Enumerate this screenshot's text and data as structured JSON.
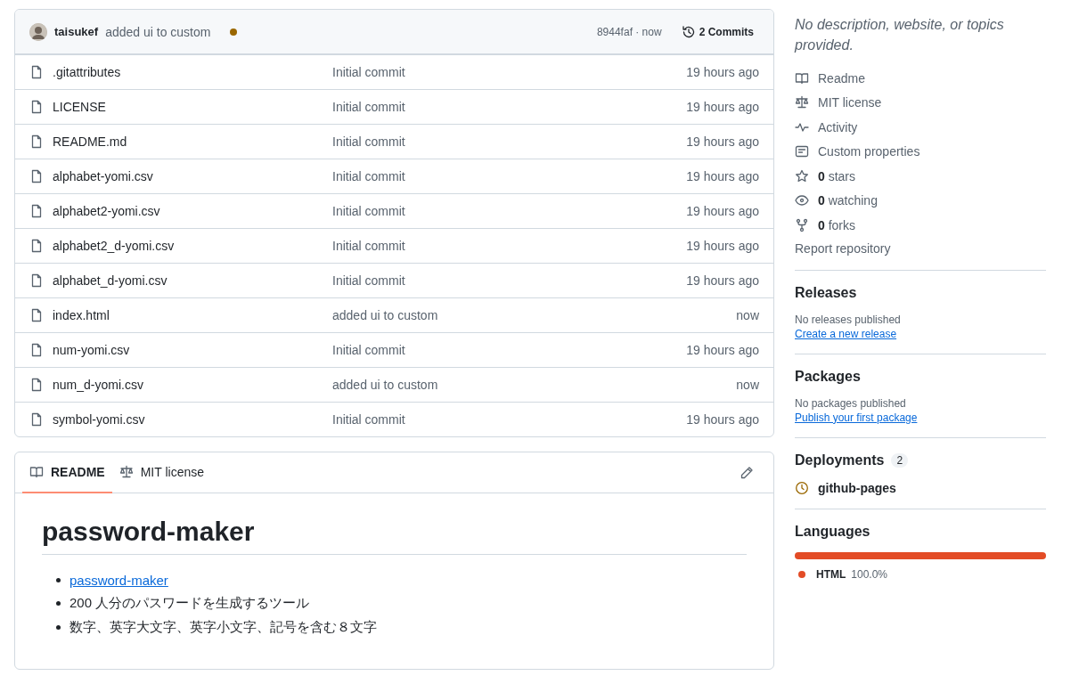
{
  "commit_bar": {
    "author": "taisukef",
    "message": "added ui to custom",
    "checks_pending": true,
    "hash": "8944faf · now",
    "commits": "2 Commits"
  },
  "files": [
    {
      "name": ".gitattributes",
      "message": "Initial commit",
      "time": "19 hours ago"
    },
    {
      "name": "LICENSE",
      "message": "Initial commit",
      "time": "19 hours ago"
    },
    {
      "name": "README.md",
      "message": "Initial commit",
      "time": "19 hours ago"
    },
    {
      "name": "alphabet-yomi.csv",
      "message": "Initial commit",
      "time": "19 hours ago"
    },
    {
      "name": "alphabet2-yomi.csv",
      "message": "Initial commit",
      "time": "19 hours ago"
    },
    {
      "name": "alphabet2_d-yomi.csv",
      "message": "Initial commit",
      "time": "19 hours ago"
    },
    {
      "name": "alphabet_d-yomi.csv",
      "message": "Initial commit",
      "time": "19 hours ago"
    },
    {
      "name": "index.html",
      "message": "added ui to custom",
      "time": "now"
    },
    {
      "name": "num-yomi.csv",
      "message": "Initial commit",
      "time": "19 hours ago"
    },
    {
      "name": "num_d-yomi.csv",
      "message": "added ui to custom",
      "time": "now"
    },
    {
      "name": "symbol-yomi.csv",
      "message": "Initial commit",
      "time": "19 hours ago"
    }
  ],
  "readme": {
    "tabs": [
      {
        "label": "README",
        "kind": "book",
        "selected": true
      },
      {
        "label": "MIT license",
        "kind": "scale",
        "selected": false
      }
    ],
    "title": "password-maker",
    "items": [
      {
        "kind": "link",
        "text": "password-maker"
      },
      {
        "kind": "text",
        "text": "200 人分のパスワードを生成するツール"
      },
      {
        "kind": "text",
        "text": "数字、英字大文字、英字小文字、記号を含む８文字"
      }
    ]
  },
  "sidebar": {
    "description": "No description, website, or topics provided.",
    "links": [
      {
        "kind": "readme",
        "text": "Readme"
      },
      {
        "kind": "license",
        "text": "MIT license"
      },
      {
        "kind": "activity",
        "text": "Activity"
      },
      {
        "kind": "properties",
        "text": "Custom properties"
      },
      {
        "kind": "stars",
        "text": "**0** stars"
      },
      {
        "kind": "watching",
        "text": "**0** watching"
      },
      {
        "kind": "forks",
        "text": "**0** forks"
      }
    ],
    "report": "Report repository",
    "releases": {
      "title": "Releases",
      "note": "No releases published",
      "link": "Create a new release"
    },
    "packages": {
      "title": "Packages",
      "note": "No packages published",
      "link": "Publish your first package"
    },
    "deployments": {
      "title": "Deployments",
      "count": "2",
      "items": [
        {
          "name": "github-pages"
        }
      ]
    },
    "languages": {
      "title": "Languages",
      "items": [
        {
          "name": "HTML",
          "percent": "100.0%",
          "level": 1,
          "color": "#e34c26"
        }
      ]
    }
  }
}
